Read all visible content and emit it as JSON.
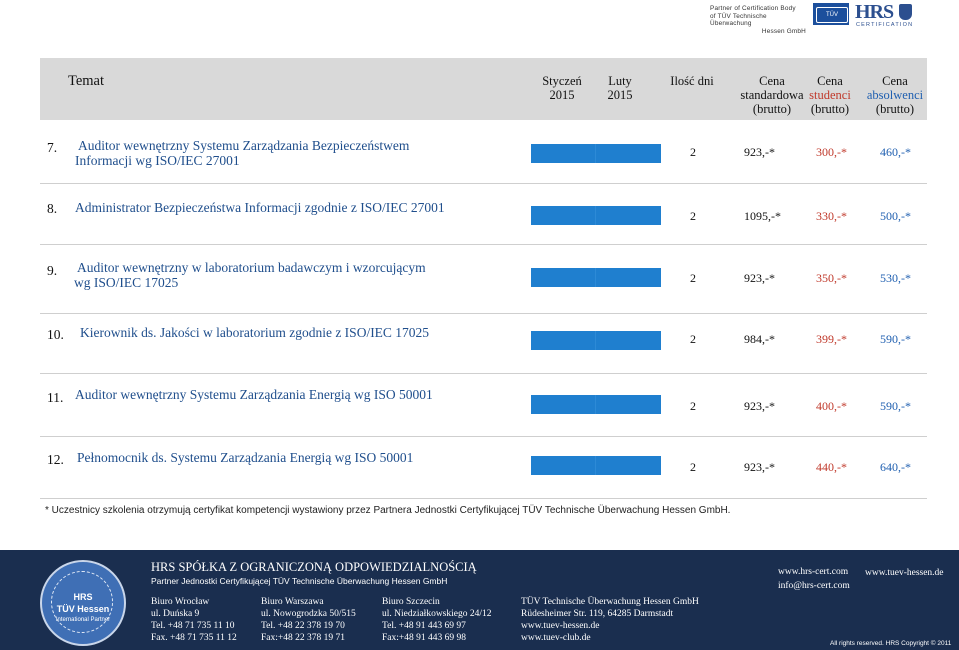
{
  "logos": {
    "partner_line1": "Partner of Certification Body",
    "partner_line2": "of TÜV Technische Überwachung",
    "partner_line3": "Hessen GmbH",
    "tuv_label": "TÜV",
    "hrs_letters": "HRS",
    "hrs_sub": "CERTIFICATION"
  },
  "table_header": {
    "temat": "Temat",
    "styczen": [
      "Styczeń",
      "2015"
    ],
    "luty": [
      "Luty",
      "2015"
    ],
    "ilosc_dni": "Ilość dni",
    "cena_std": [
      "Cena",
      "standardowa",
      "(brutto)"
    ],
    "cena_stu": [
      "Cena",
      "studenci",
      "(brutto)"
    ],
    "cena_abs": [
      "Cena",
      "absolwenci",
      "(brutto)"
    ]
  },
  "rows": [
    {
      "num": "7.",
      "title": [
        "Auditor wewnętrzny Systemu Zarządzania Bezpieczeństwem",
        "Informacji wg ISO/IEC 27001"
      ],
      "days": "2",
      "std": "923,-*",
      "stu": "300,-*",
      "abs": "460,-*"
    },
    {
      "num": "8.",
      "title": [
        "Administrator Bezpieczeństwa Informacji zgodnie z ISO/IEC 27001"
      ],
      "days": "2",
      "std": "1095,-*",
      "stu": "330,-*",
      "abs": "500,-*"
    },
    {
      "num": "9.",
      "title": [
        "Auditor wewnętrzny w laboratorium badawczym i wzorcującym",
        "wg ISO/IEC 17025"
      ],
      "days": "2",
      "std": "923,-*",
      "stu": "350,-*",
      "abs": "530,-*"
    },
    {
      "num": "10.",
      "title": [
        "Kierownik ds. Jakości w laboratorium zgodnie z ISO/IEC 17025"
      ],
      "days": "2",
      "std": "984,-*",
      "stu": "399,-*",
      "abs": "590,-*"
    },
    {
      "num": "11.",
      "title": [
        "Auditor wewnętrzny Systemu Zarządzania Energią wg ISO 50001"
      ],
      "days": "2",
      "std": "923,-*",
      "stu": "400,-*",
      "abs": "590,-*"
    },
    {
      "num": "12.",
      "title": [
        "Pełnomocnik ds. Systemu Zarządzania Energią wg ISO 50001"
      ],
      "days": "2",
      "std": "923,-*",
      "stu": "440,-*",
      "abs": "640,-*"
    }
  ],
  "footnote": "* Uczestnicy szkolenia otrzymują certyfikat kompetencji  wystawiony przez  Partnera Jednostki Certyfikującej TÜV Technische Überwachung Hessen GmbH.",
  "footer": {
    "company": "HRS SPÓŁKA Z OGRANICZONĄ ODPOWIEDZIALNOŚCIĄ",
    "company_sub": "Partner Jednostki Certyfikującej TÜV Technische Überwachung Hessen GmbH",
    "seal": {
      "line1": "HRS",
      "line2": "TÜV Hessen",
      "line3": "International Partner"
    },
    "wroclaw": [
      "Biuro Wrocław",
      "ul. Duńska 9",
      "Tel. +48 71 735 11 10",
      "Fax. +48 71 735  11 12"
    ],
    "warszawa": [
      "Biuro Warszawa",
      "ul. Nowogrodzka 50/515",
      "Tel. +48 22 378 19 70",
      "Fax:+48 22 378 19 71"
    ],
    "szczecin": [
      "Biuro Szczecin",
      "ul. Niedziałkowskiego 24/12",
      "Tel. +48 91 443 69 97",
      "Fax:+48  91 443 69 98"
    ],
    "tuv": [
      "TÜV Technische Überwachung Hessen GmbH",
      "Rüdesheimer Str. 119, 64285 Darmstadt",
      "www.tuev-hessen.de",
      "www.tuev-club.de"
    ],
    "web1": "www.hrs-cert.com",
    "web2": "info@hrs-cert.com",
    "web3": "www.tuev-hessen.de",
    "copyright": "All rights reserved. HRS Copyright © 2011"
  }
}
